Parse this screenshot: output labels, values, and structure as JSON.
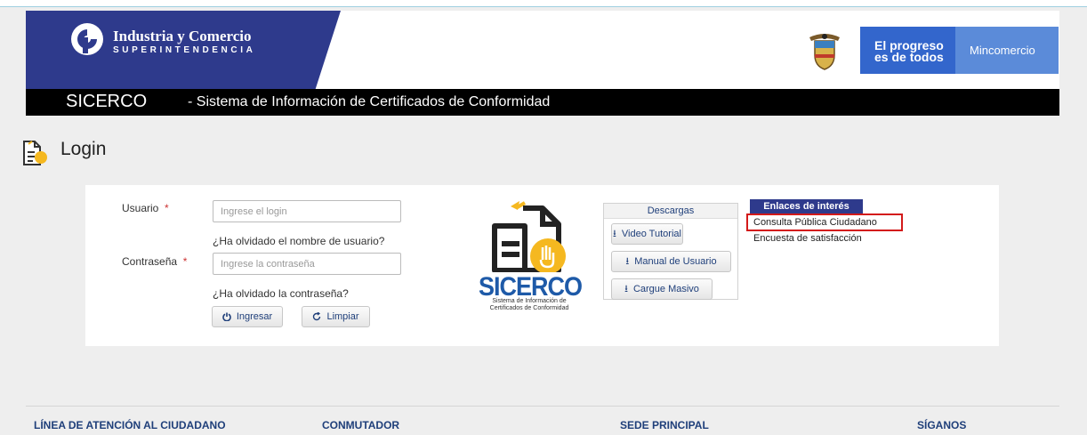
{
  "header": {
    "sic_name": "Industria y Comercio",
    "sic_sub": "SUPERINTENDENCIA",
    "gov_progress": "El progreso es de todos",
    "gov_ministry": "Mincomercio",
    "brand_color": "#2e3a8c"
  },
  "titlebar": {
    "acronym": "SICERCO",
    "full_name": " - Sistema de Información de Certificados de Conformidad"
  },
  "page": {
    "title": "Login"
  },
  "login": {
    "user_label": "Usuario",
    "required_mark": "*",
    "user_placeholder": "Ingrese el login",
    "forgot_user": "¿Ha olvidado el nombre de usuario?",
    "password_label": "Contraseña",
    "password_placeholder": "Ingrese la contraseña",
    "forgot_password": "¿Ha olvidado la contraseña?",
    "login_button": "Ingresar",
    "clear_button": "Limpiar"
  },
  "logo": {
    "word": "SICERCO",
    "caption_line1": "Sistema de Información de",
    "caption_line2": "Certificados de Conformidad"
  },
  "downloads": {
    "title": "Descargas",
    "items": [
      "Video Tutorial",
      "Manual de Usuario",
      "Cargue Masivo"
    ]
  },
  "links": {
    "title": "Enlaces de interés",
    "items": [
      "Consulta Pública Ciudadano",
      "Encuesta de satisfacción"
    ],
    "highlight_color": "#d31a1a"
  },
  "footer": {
    "col1": "LÍNEA DE ATENCIÓN AL CIUDADANO",
    "col2": "CONMUTADOR",
    "col3": "SEDE PRINCIPAL",
    "col4": "SÍGANOS"
  }
}
